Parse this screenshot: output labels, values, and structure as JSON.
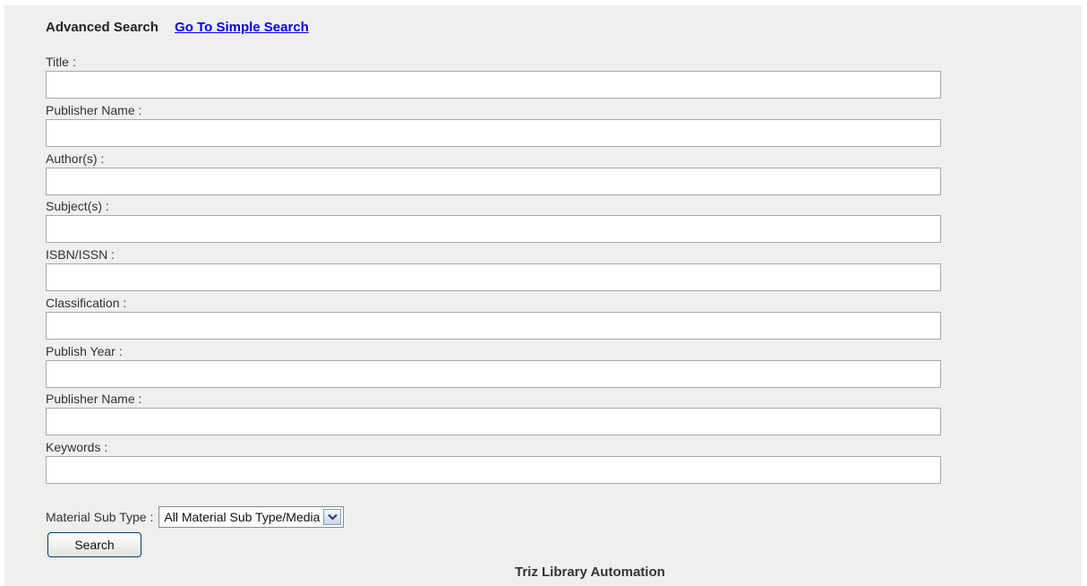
{
  "header": {
    "title": "Advanced Search",
    "simple_search_link": "Go To Simple Search"
  },
  "fields": {
    "title": {
      "label": "Title :",
      "value": ""
    },
    "publisher_name": {
      "label": "Publisher Name :",
      "value": ""
    },
    "authors": {
      "label": "Author(s) :",
      "value": ""
    },
    "subjects": {
      "label": "Subject(s) :",
      "value": ""
    },
    "isbn_issn": {
      "label": "ISBN/ISSN :",
      "value": ""
    },
    "classification": {
      "label": "Classification :",
      "value": ""
    },
    "publish_year": {
      "label": "Publish Year :",
      "value": ""
    },
    "publisher_name_2": {
      "label": "Publisher Name :",
      "value": ""
    },
    "keywords": {
      "label": "Keywords :",
      "value": ""
    }
  },
  "material_sub_type": {
    "label": "Material Sub Type :",
    "selected": "All Material Sub Type/Media"
  },
  "search_button": "Search",
  "footer": "Triz Library Automation",
  "colors": {
    "panel_bg": "#efefef",
    "link": "#0000ee"
  },
  "icons": {
    "dropdown": "chevron-down-icon"
  }
}
